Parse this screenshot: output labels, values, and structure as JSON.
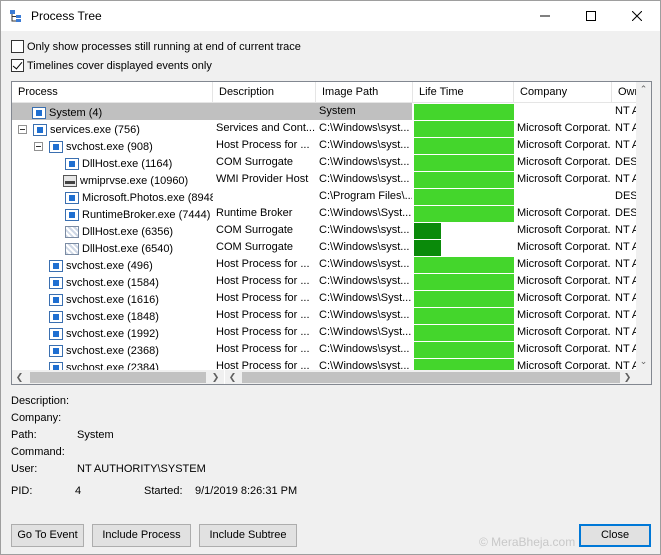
{
  "window": {
    "title": "Process Tree",
    "icon": "process-tree-icon"
  },
  "options": [
    {
      "label": "Only show processes still running at end of current trace",
      "checked": false
    },
    {
      "label": "Timelines cover displayed events only",
      "checked": true
    }
  ],
  "table": {
    "columns": [
      "Process",
      "Description",
      "Image Path",
      "Life Time",
      "Company",
      "Own"
    ],
    "rows": [
      {
        "process": "System (4)",
        "description": "",
        "image_path": "System",
        "life_time": 1.0,
        "company": "",
        "owner": "NT A",
        "selected": true
      },
      {
        "process": "services.exe (756)",
        "description": "Services and Cont...",
        "image_path": "C:\\Windows\\syst...",
        "life_time": 1.0,
        "company": "Microsoft Corporat...",
        "owner": "NT A"
      },
      {
        "process": "svchost.exe (908)",
        "description": "Host Process for ...",
        "image_path": "C:\\Windows\\syst...",
        "life_time": 1.0,
        "company": "Microsoft Corporat...",
        "owner": "NT A"
      },
      {
        "process": "DllHost.exe (1164)",
        "description": "COM Surrogate",
        "image_path": "C:\\Windows\\syst...",
        "life_time": 1.0,
        "company": "Microsoft Corporat...",
        "owner": "DES"
      },
      {
        "process": "wmiprvse.exe (10960)",
        "description": "WMI Provider Host",
        "image_path": "C:\\Windows\\syst...",
        "life_time": 1.0,
        "company": "Microsoft Corporat...",
        "owner": "NT A"
      },
      {
        "process": "Microsoft.Photos.exe (8948)",
        "description": "",
        "image_path": "C:\\Program Files\\...",
        "life_time": 1.0,
        "company": "",
        "owner": "DES"
      },
      {
        "process": "RuntimeBroker.exe (7444)",
        "description": "Runtime Broker",
        "image_path": "C:\\Windows\\Syst...",
        "life_time": 1.0,
        "company": "Microsoft Corporat...",
        "owner": "DES"
      },
      {
        "process": "DllHost.exe (6356)",
        "description": "COM Surrogate",
        "image_path": "C:\\Windows\\syst...",
        "life_time": 0.27,
        "company": "Microsoft Corporat...",
        "owner": "NT A"
      },
      {
        "process": "DllHost.exe (6540)",
        "description": "COM Surrogate",
        "image_path": "C:\\Windows\\syst...",
        "life_time": 0.27,
        "company": "Microsoft Corporat...",
        "owner": "NT A"
      },
      {
        "process": "svchost.exe (496)",
        "description": "Host Process for ...",
        "image_path": "C:\\Windows\\syst...",
        "life_time": 1.0,
        "company": "Microsoft Corporat...",
        "owner": "NT A"
      },
      {
        "process": "svchost.exe (1584)",
        "description": "Host Process for ...",
        "image_path": "C:\\Windows\\syst...",
        "life_time": 1.0,
        "company": "Microsoft Corporat...",
        "owner": "NT A"
      },
      {
        "process": "svchost.exe (1616)",
        "description": "Host Process for ...",
        "image_path": "C:\\Windows\\Syst...",
        "life_time": 1.0,
        "company": "Microsoft Corporat...",
        "owner": "NT A"
      },
      {
        "process": "svchost.exe (1848)",
        "description": "Host Process for ...",
        "image_path": "C:\\Windows\\syst...",
        "life_time": 1.0,
        "company": "Microsoft Corporat...",
        "owner": "NT A"
      },
      {
        "process": "svchost.exe (1992)",
        "description": "Host Process for ...",
        "image_path": "C:\\Windows\\Syst...",
        "life_time": 1.0,
        "company": "Microsoft Corporat...",
        "owner": "NT A"
      },
      {
        "process": "svchost.exe (2368)",
        "description": "Host Process for ...",
        "image_path": "C:\\Windows\\syst...",
        "life_time": 1.0,
        "company": "Microsoft Corporat...",
        "owner": "NT A"
      },
      {
        "process": "svchost.exe (2384)",
        "description": "Host Process for ...",
        "image_path": "C:\\Windows\\syst...",
        "life_time": 1.0,
        "company": "Microsoft Corporat...",
        "owner": "NT A"
      }
    ]
  },
  "details": {
    "description_label": "Description:",
    "company_label": "Company:",
    "path_label": "Path:",
    "path_value": "System",
    "command_label": "Command:",
    "user_label": "User:",
    "user_value": "NT AUTHORITY\\SYSTEM",
    "pid_label": "PID:",
    "pid_value": "4",
    "started_label": "Started:",
    "started_value": "9/1/2019 8:26:31 PM"
  },
  "buttons": {
    "go_to_event": "Go To Event",
    "include_process": "Include Process",
    "include_subtree": "Include Subtree",
    "close": "Close"
  },
  "watermark": "© MeraBheja.com",
  "colors": {
    "lifetime_full": "#44d62c",
    "lifetime_short": "#0a8a0a",
    "selection": "#c0c0c0",
    "focus_border": "#0078d7"
  }
}
